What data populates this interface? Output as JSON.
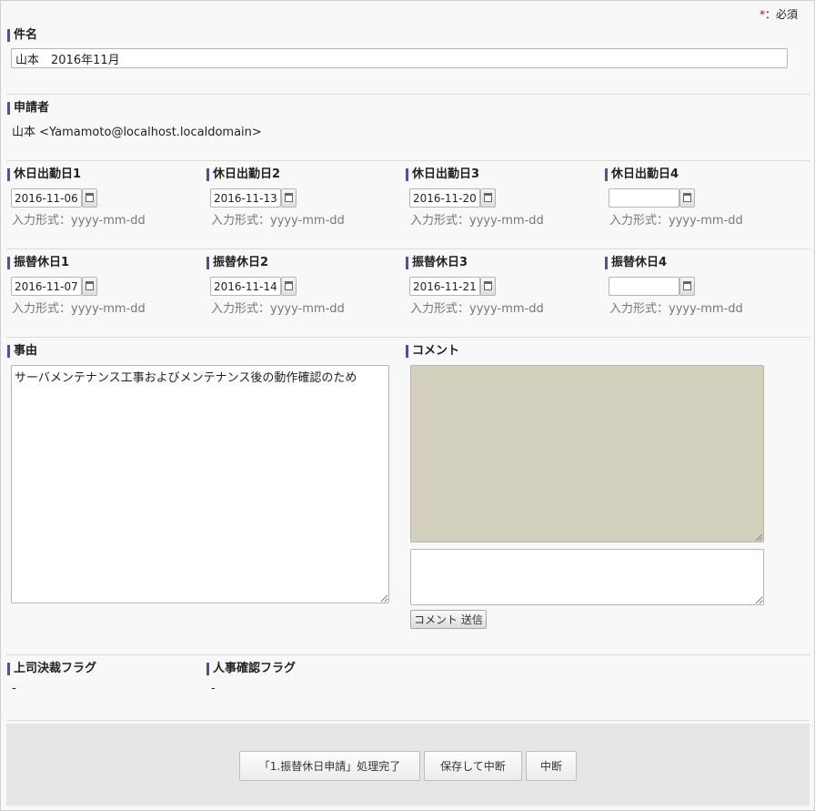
{
  "required_note": {
    "star": "*",
    "text": "：必須"
  },
  "subject": {
    "label": "件名",
    "value": "山本　2016年11月"
  },
  "applicant": {
    "label": "申請者",
    "value": "山本 <Yamamoto@localhost.localdomain>"
  },
  "date_format_hint": "入力形式：yyyy-mm-dd",
  "holiday_work_days": [
    {
      "label": "休日出勤日1",
      "value": "2016-11-06"
    },
    {
      "label": "休日出勤日2",
      "value": "2016-11-13"
    },
    {
      "label": "休日出勤日3",
      "value": "2016-11-20"
    },
    {
      "label": "休日出勤日4",
      "value": ""
    }
  ],
  "substitute_holidays": [
    {
      "label": "振替休日1",
      "value": "2016-11-07"
    },
    {
      "label": "振替休日2",
      "value": "2016-11-14"
    },
    {
      "label": "振替休日3",
      "value": "2016-11-21"
    },
    {
      "label": "振替休日4",
      "value": ""
    }
  ],
  "reason": {
    "label": "事由",
    "value": "サーバメンテナンス工事およびメンテナンス後の動作確認のため"
  },
  "comment": {
    "label": "コメント",
    "input_value": "",
    "send_label": "コメント 送信"
  },
  "flags": [
    {
      "label": "上司決裁フラグ",
      "value": "-"
    },
    {
      "label": "人事確認フラグ",
      "value": "-"
    }
  ],
  "actions": {
    "complete_label": "「1.振替休日申請」処理完了",
    "save_label": "保存して中断",
    "abort_label": "中断"
  },
  "colors": {
    "accent_bar": "#5c4d8e",
    "comment_log_bg": "#d3d1bd",
    "footer_bg": "#e6e6e6"
  }
}
